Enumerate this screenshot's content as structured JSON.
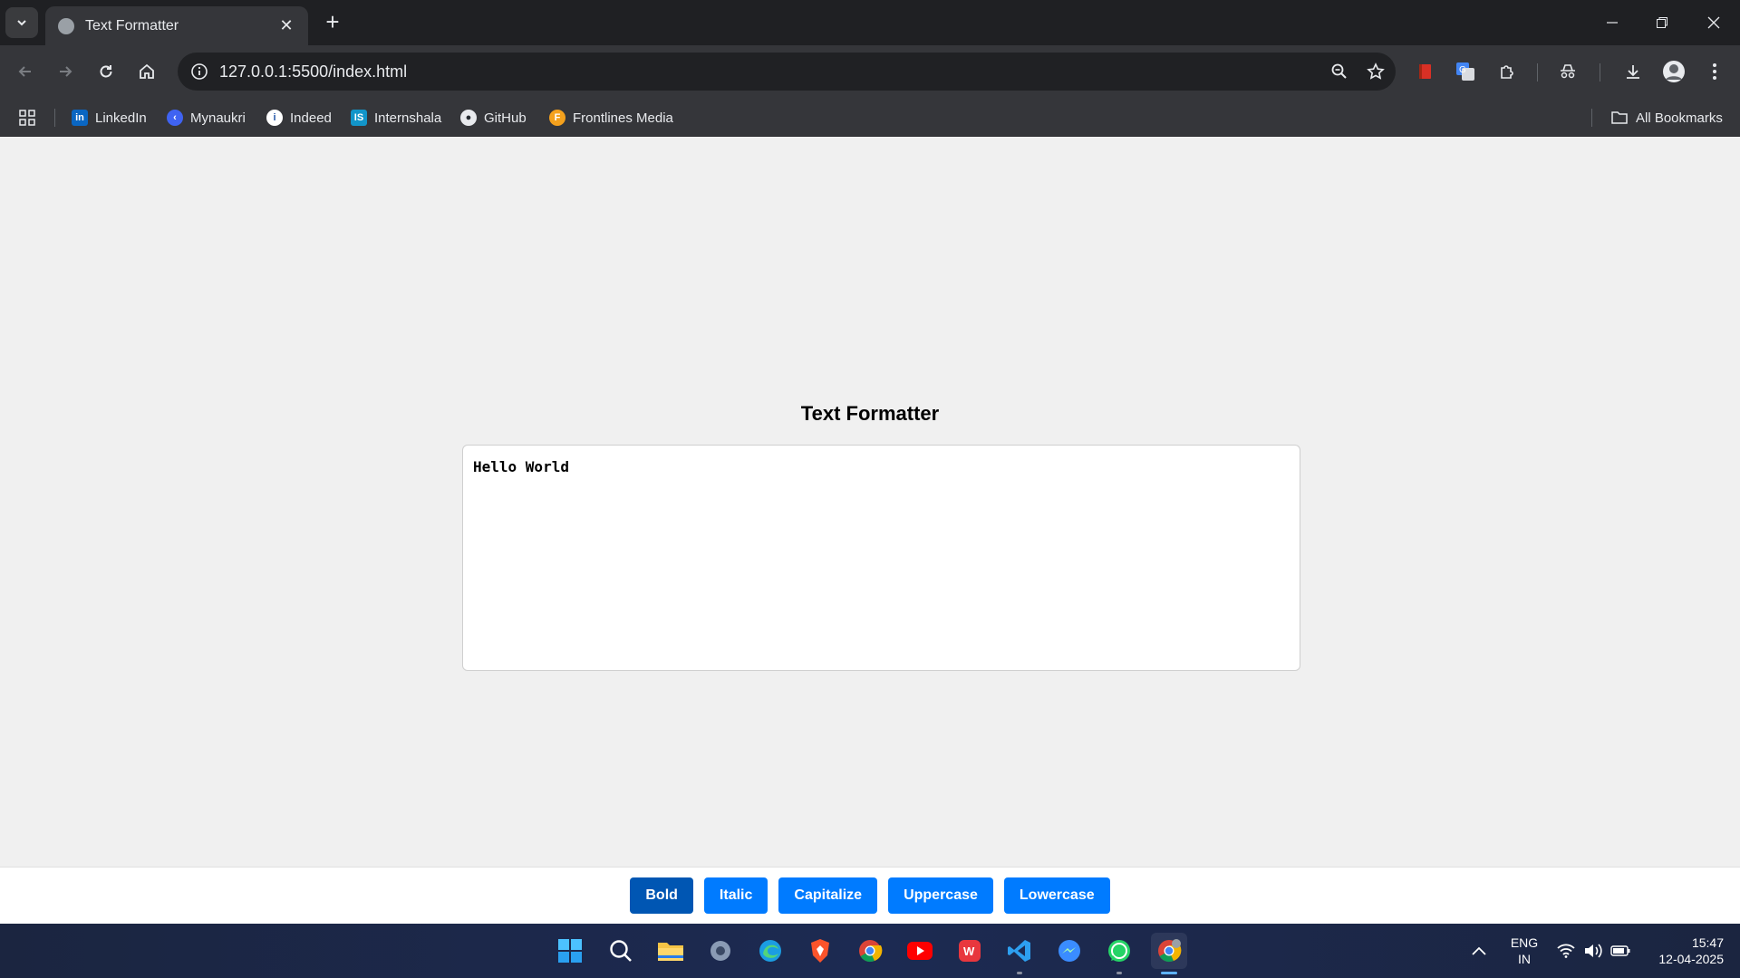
{
  "browser": {
    "tab_title": "Text Formatter",
    "url": "127.0.0.1:5500/index.html",
    "bookmarks": [
      {
        "label": "LinkedIn",
        "icon": "linkedin-icon"
      },
      {
        "label": "Mynaukri",
        "icon": "mynaukri-icon"
      },
      {
        "label": "Indeed",
        "icon": "indeed-icon"
      },
      {
        "label": "Internshala",
        "icon": "internshala-icon"
      },
      {
        "label": "GitHub",
        "icon": "github-icon"
      },
      {
        "label": "Frontlines Media",
        "icon": "frontlines-icon"
      }
    ],
    "all_bookmarks": "All Bookmarks"
  },
  "page": {
    "heading": "Text Formatter",
    "editor_text": "Hello World",
    "buttons": {
      "bold": "Bold",
      "italic": "Italic",
      "capitalize": "Capitalize",
      "uppercase": "Uppercase",
      "lowercase": "Lowercase"
    },
    "active_button": "Bold",
    "colors": {
      "button": "#007bff",
      "button_active": "#0056b3"
    }
  },
  "taskbar": {
    "apps": [
      "start-icon",
      "search-icon",
      "file-explorer-icon",
      "settings-icon",
      "edge-icon",
      "brave-icon",
      "chrome-icon",
      "youtube-icon",
      "wps-icon",
      "vscode-icon",
      "messenger-icon",
      "whatsapp-icon",
      "chrome-profile-icon"
    ],
    "lang_line1": "ENG",
    "lang_line2": "IN",
    "time": "15:47",
    "date": "12-04-2025"
  }
}
